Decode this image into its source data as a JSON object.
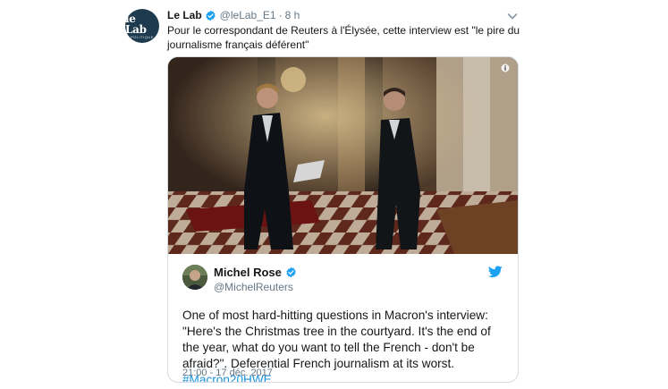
{
  "tweet": {
    "avatar": {
      "line1": "le Lab",
      "line2": "POLITIQUE"
    },
    "name": "Le Lab",
    "handle": "@leLab_E1",
    "separator": "·",
    "time": "8 h",
    "text": "Pour le correspondant de Reuters à l'Élysée, cette interview est \"le pire du journalisme français déférent\""
  },
  "quoted": {
    "name": "Michel Rose",
    "handle": "@MichelReuters",
    "text": "One of most hard-hitting questions in Macron's interview: \"Here's the Christmas tree in the courtyard. It's the end of the year, what do you want to tell the French - don't be afraid?\". Deferential French journalism at its worst. ",
    "hashtag": "#Macron20HWE",
    "date": "21:00 - 17 déc. 2017"
  },
  "colors": {
    "link": "#1b95e0",
    "verified": "#1da1f2",
    "secondary_text": "#657786"
  },
  "icons": [
    "verified-badge-icon",
    "chevron-down-icon",
    "info-icon",
    "twitter-bird-icon"
  ]
}
